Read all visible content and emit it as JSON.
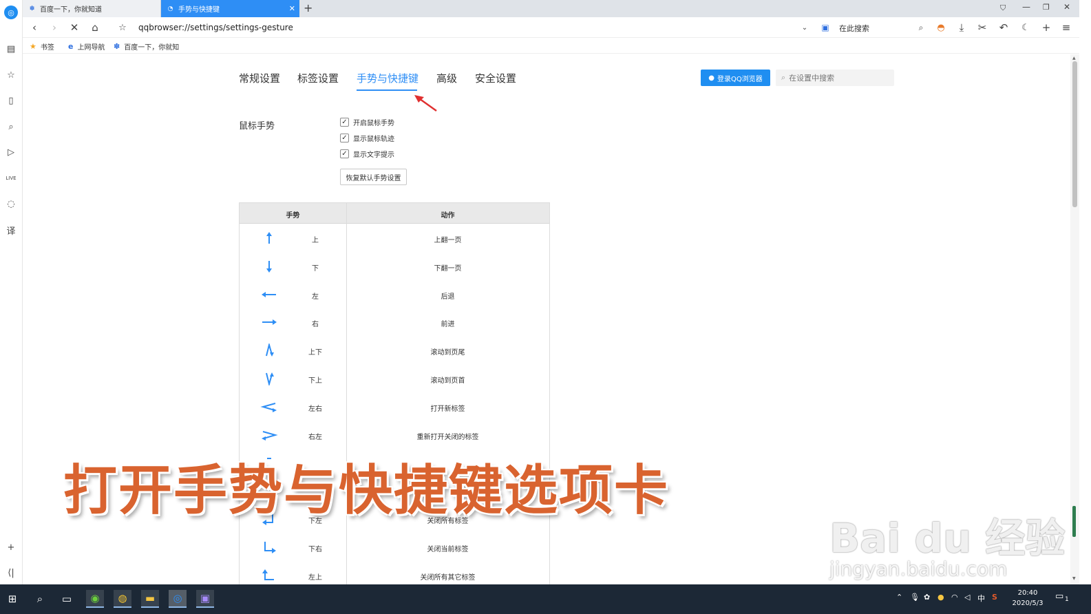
{
  "browser": {
    "tabs": [
      {
        "title": "百度一下，你就知道",
        "active": false
      },
      {
        "title": "手势与快捷键",
        "active": true
      }
    ],
    "address": "qqbrowser://settings/settings-gesture",
    "search_placeholder": "在此搜索"
  },
  "bookmarks": [
    {
      "label": "书签",
      "icon": "star-icon"
    },
    {
      "label": "上网导航",
      "icon": "e-icon"
    },
    {
      "label": "百度一下，你就知",
      "icon": "baidu-paw-icon"
    }
  ],
  "settings": {
    "tabs": [
      "常规设置",
      "标签设置",
      "手势与快捷键",
      "高级",
      "安全设置"
    ],
    "active_tab": "手势与快捷键",
    "login_button": "登录QQ浏览器",
    "search_placeholder": "在设置中搜索",
    "mouse_gesture": {
      "section_title": "鼠标手势",
      "options": [
        {
          "label": "开启鼠标手势",
          "checked": true
        },
        {
          "label": "显示鼠标轨迹",
          "checked": true
        },
        {
          "label": "显示文字提示",
          "checked": true
        }
      ],
      "reset_button": "恢复默认手势设置"
    },
    "gesture_table": {
      "headers": [
        "手势",
        "动作"
      ],
      "rows": [
        {
          "icon": "arrow-up-icon",
          "direction": "上",
          "action": "上翻一页"
        },
        {
          "icon": "arrow-down-icon",
          "direction": "下",
          "action": "下翻一页"
        },
        {
          "icon": "arrow-left-icon",
          "direction": "左",
          "action": "后退"
        },
        {
          "icon": "arrow-right-icon",
          "direction": "右",
          "action": "前进"
        },
        {
          "icon": "arrow-up-down-icon",
          "direction": "上下",
          "action": "滚动到页尾"
        },
        {
          "icon": "arrow-down-up-icon",
          "direction": "下上",
          "action": "滚动到页首"
        },
        {
          "icon": "arrow-left-right-icon",
          "direction": "左右",
          "action": "打开新标签"
        },
        {
          "icon": "arrow-right-left-icon",
          "direction": "右左",
          "action": "重新打开关闭的标签"
        },
        {
          "icon": "arrow-partial-icon",
          "direction": "",
          "action": ""
        },
        {
          "icon": "arrow-partial-icon",
          "direction": "",
          "action": ""
        },
        {
          "icon": "arrow-down-left-icon",
          "direction": "下左",
          "action": "关闭所有标签"
        },
        {
          "icon": "arrow-down-right-icon",
          "direction": "下右",
          "action": "关闭当前标签"
        },
        {
          "icon": "arrow-left-up-icon",
          "direction": "左上",
          "action": "关闭所有其它标签"
        }
      ]
    }
  },
  "overlay": {
    "caption": "打开手势与快捷键选项卡",
    "watermark_brand": "Bai du 经验",
    "watermark_url": "jingyan.baidu.com"
  },
  "taskbar": {
    "tray_lang": "中",
    "time": "20:40",
    "date": "2020/5/3",
    "notification_count": "1"
  },
  "colors": {
    "accent": "#2e8ef5",
    "caption": "#d9632f",
    "taskbar": "#1c2836"
  }
}
